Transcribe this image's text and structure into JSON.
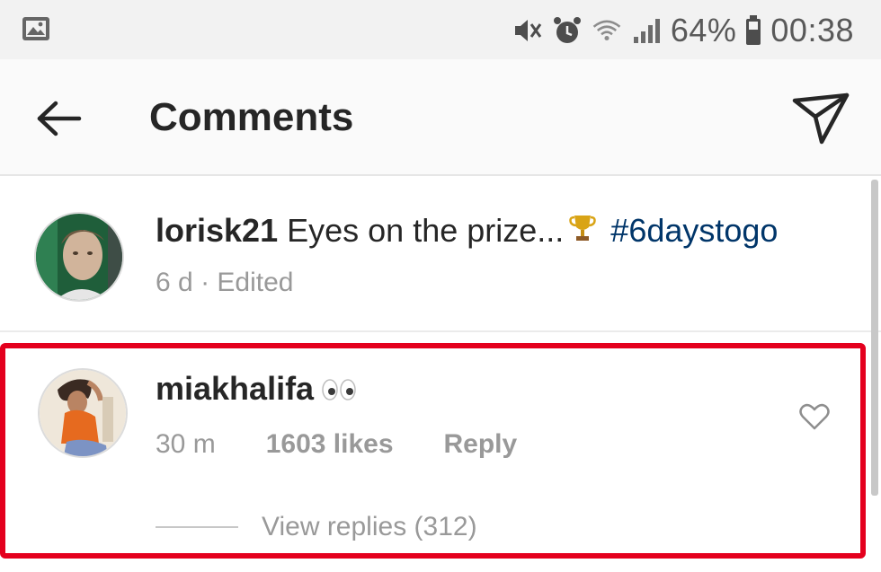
{
  "status_bar": {
    "battery_percent": "64%",
    "time": "00:38",
    "icons": [
      "gallery-icon",
      "vibrate-mute-icon",
      "alarm-icon",
      "wifi-icon",
      "signal-icon",
      "battery-icon"
    ]
  },
  "header": {
    "title": "Comments",
    "back_icon": "back-arrow-icon",
    "send_icon": "paper-plane-icon"
  },
  "caption": {
    "username": "lorisk21",
    "text": "Eyes on the prize...",
    "emoji": "trophy",
    "hashtag": "#6daystogo",
    "time": "6 d",
    "separator": "·",
    "edited": "Edited"
  },
  "comment": {
    "username": "miakhalifa",
    "emoji": "eyes",
    "time": "30 m",
    "likes": "1603 likes",
    "reply_label": "Reply",
    "view_replies": "View replies (312)",
    "highlight_color": "#e4001e"
  },
  "colors": {
    "hashtag": "#003569",
    "meta_text": "#999999",
    "primary_text": "#262626"
  }
}
